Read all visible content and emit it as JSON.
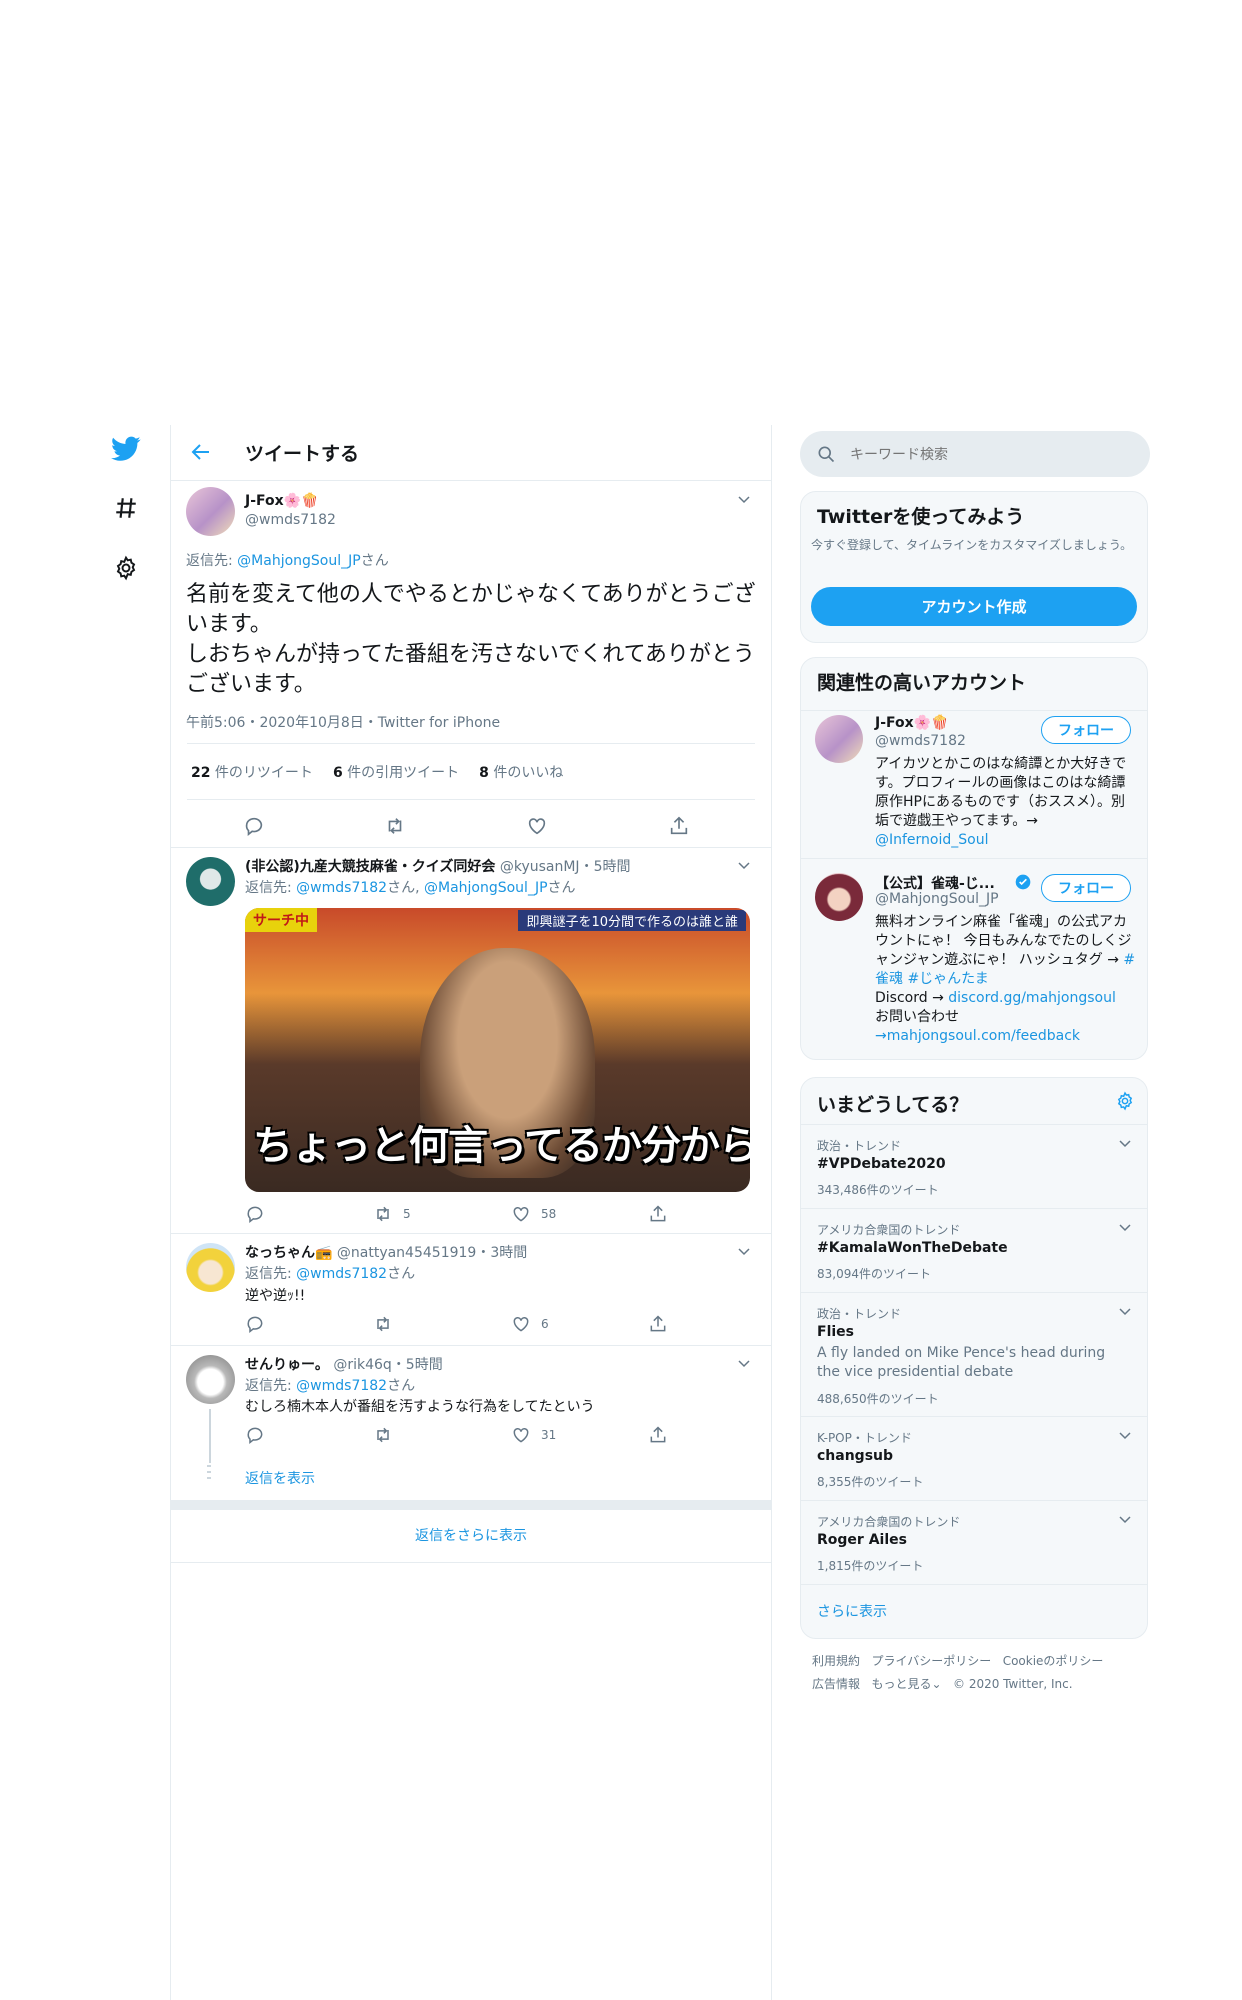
{
  "header": {
    "title": "ツイートする"
  },
  "tweet": {
    "name": "J-Fox🌸🍿",
    "handle": "@wmds7182",
    "reply_prefix": "返信先: ",
    "reply_to": "@MahjongSoul_JP",
    "reply_suffix": "さん",
    "text_line1": "名前を変えて他の人でやるとかじゃなくてありがとうございます。",
    "text_line2": "しおちゃんが持ってた番組を汚さないでくれてありがとうございます。",
    "time": "午前5:06・2020年10月8日・Twitter for iPhone",
    "retweets_count": "22",
    "retweets_label": " 件のリツイート",
    "quotes_count": "6",
    "quotes_label": " 件の引用ツイート",
    "likes_count": "8",
    "likes_label": " 件のいいね"
  },
  "replies": [
    {
      "name": "(非公認)九産大競技麻雀・クイズ同好会",
      "handle": "@kyusanMJ",
      "time": "・5時間",
      "reply_prefix": "返信先: ",
      "reply_to": "@wmds7182",
      "reply_mid": "さん, ",
      "reply_to2": "@MahjongSoul_JP",
      "reply_suffix": "さん",
      "image_caption": "ちょっと何言ってるか分からない",
      "image_top_label": "サーチ中",
      "image_banner": "即興謎子を10分間で作るのは誰と誰",
      "retweets": "5",
      "likes": "58"
    },
    {
      "name": "なっちゃん📻",
      "handle": "@nattyan45451919",
      "time": "・3時間",
      "reply_prefix": "返信先: ",
      "reply_to": "@wmds7182",
      "reply_suffix": "さん",
      "text": "逆や逆ｯ!!",
      "retweets": "",
      "likes": "6"
    },
    {
      "name": "せんりゅー。",
      "handle": "@rik46q",
      "time": "・5時間",
      "reply_prefix": "返信先: ",
      "reply_to": "@wmds7182",
      "reply_suffix": "さん",
      "text": "むしろ楠木本人が番組を汚すような行為をしてたという",
      "retweets": "",
      "likes": "31",
      "show_replies": "返信を表示"
    }
  ],
  "more_replies": "返信をさらに表示",
  "search": {
    "placeholder": "キーワード検索"
  },
  "signup": {
    "title": "Twitterを使ってみよう",
    "desc": "今すぐ登録して、タイムラインをカスタマイズしましょう。",
    "button": "アカウント作成"
  },
  "related": {
    "title": "関連性の高いアカウント",
    "follow_label": "フォロー",
    "accounts": [
      {
        "name": "J-Fox🌸🍿",
        "handle": "@wmds7182",
        "bio": "アイカツとかこのはな綺譚とか大好きです。プロフィールの画像はこのはな綺譚原作HPにあるものです（おススメ）。別垢で遊戯王やってます。→",
        "bio_link": "@Infernoid_Soul"
      },
      {
        "name": "【公式】雀魂-じ...",
        "handle": "@MahjongSoul_JP",
        "bio1": "無料オンライン麻雀「雀魂」の公式アカウントにゃ！ 今日もみんなでたのしくジャンジャン遊ぶにゃ！ ハッシュタグ →",
        "bio_tag1": "#雀魂",
        "bio_tag2": "#じゃんたま",
        "bio2": "Discord →",
        "bio_link2": "discord.gg/mahjongsoul",
        "bio3": "お問い合わせ",
        "bio_link3": "→mahjongsoul.com/feedback"
      }
    ]
  },
  "trends": {
    "title": "いまどうしてる？",
    "items": [
      {
        "meta": "政治・トレンド",
        "name": "#VPDebate2020",
        "count": "343,486件のツイート"
      },
      {
        "meta": "アメリカ合衆国のトレンド",
        "name": "#KamalaWonTheDebate",
        "count": "83,094件のツイート"
      },
      {
        "meta": "政治・トレンド",
        "name": "Flies",
        "desc": "A fly landed on Mike Pence's head during the vice presidential debate",
        "count": "488,650件のツイート"
      },
      {
        "meta": "K-POP・トレンド",
        "name": "changsub",
        "count": "8,355件のツイート"
      },
      {
        "meta": "アメリカ合衆国のトレンド",
        "name": "Roger Ailes",
        "count": "1,815件のツイート"
      }
    ],
    "show_more": "さらに表示"
  },
  "footer": {
    "terms": "利用規約",
    "privacy": "プライバシーポリシー",
    "cookie": "Cookieのポリシー",
    "ads": "広告情報",
    "more": "もっと見る",
    "copyright": "© 2020 Twitter, Inc."
  },
  "colors": {
    "accent": "#1da1f2",
    "link": "#1b95e0",
    "muted": "#657786"
  }
}
